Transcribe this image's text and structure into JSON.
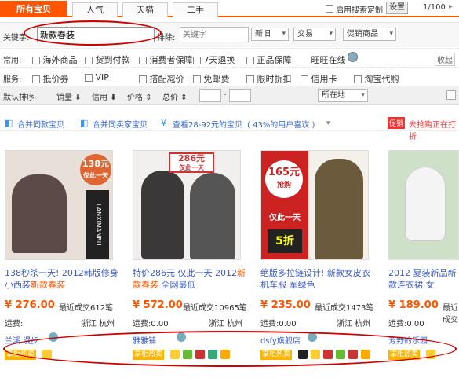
{
  "tabs": [
    "所有宝贝",
    "人气",
    "天猫",
    "二手"
  ],
  "search_setting": {
    "label": "启用搜索定制",
    "button": "设置"
  },
  "page_indicator": "1/100",
  "keyword": {
    "label": "关键字:",
    "value": "新款春装",
    "exclude_label": "排除:",
    "exclude_placeholder": "关键字"
  },
  "selects": [
    "新旧",
    "交易",
    "促销商品"
  ],
  "common_label": "常用:",
  "service_label": "服务:",
  "collapse": "收起",
  "common_options": [
    "海外商品",
    "货到付款",
    "消费者保障",
    "7天退换",
    "正品保障",
    "旺旺在线"
  ],
  "service_options": [
    "抵价券",
    "VIP",
    "搭配减价",
    "免邮费",
    "限时折扣",
    "信用卡",
    "淘宝代购"
  ],
  "sort": {
    "items": [
      "默认排序",
      "销量",
      "信用",
      "价格",
      "总价"
    ],
    "range_sep": "-",
    "location": "所在地"
  },
  "merge": {
    "same_item": "合并同款宝贝",
    "same_shop": "合并同卖家宝贝",
    "price_view": "查看28-92元的宝贝",
    "percent": "( 43%的用户喜欢 )",
    "promo_badge": "促销",
    "promo_text": "去抢购正在打折"
  },
  "items": [
    {
      "img_text": "138元",
      "img_sub": "仅此一天",
      "img_brand": "LANXIMANBU",
      "title_a": "138秒杀一天! 2012韩版修身小西装",
      "title_hl": "新款春装",
      "price": "276.00",
      "sold": "最近成交612笔",
      "freight": "运费:",
      "loc_a": "浙江",
      "loc_b": "杭州",
      "shop": "兰溪 漫步",
      "badge": "掌柜热卖"
    },
    {
      "img_text": "286元",
      "img_sub": "仅此一天",
      "img_brand": "",
      "title_a": "特价286元 仅此一天 2012",
      "title_hl": "新款春装",
      "title_b": "全网最低",
      "price": "572.00",
      "sold": "最近成交10965笔",
      "freight": "运费:",
      "freight_val": "0.00",
      "loc_a": "浙江",
      "loc_b": "杭州",
      "shop": "雅雅铺",
      "badge": "掌柜热卖"
    },
    {
      "img_text": "165元",
      "img_sub": "抢购",
      "img_brand": "仅此一天",
      "img_disc": "5折",
      "title_a": "绝版多拉链设计! 新款女皮衣机车服 军绿色",
      "title_hl": "",
      "price": "235.00",
      "sold": "最近成交1473笔",
      "freight": "运费:",
      "freight_val": "0.00",
      "loc_a": "浙江",
      "loc_b": "杭州",
      "shop": "dsfy旗舰店",
      "badge": "掌柜热卖"
    },
    {
      "img_text": "",
      "img_sub": "",
      "img_brand": "",
      "title_a": "2012 夏装新品新款连衣裙 女",
      "title_hl": "",
      "price": "189.00",
      "sold": "最近成交",
      "freight": "运费:",
      "freight_val": "0.00",
      "loc_a": "",
      "loc_b": "",
      "shop": "芳野的乐园",
      "badge": "掌柜热卖"
    }
  ]
}
